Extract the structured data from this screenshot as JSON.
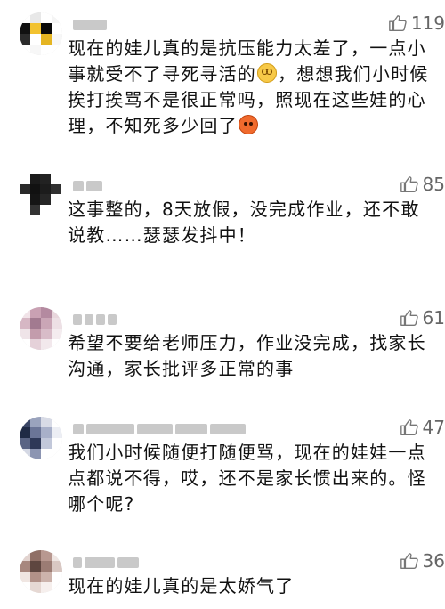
{
  "comments": [
    {
      "likes": "119",
      "text_a": "现在的娃儿真的是抗压能力太差了，一点小事就受不了寻死寻活的",
      "emoji_a": "dizzy-face-emoji",
      "text_b": "，想想我们小时候挨打挨骂不是很正常吗，照现在这些娃的心理，不知死多少回了",
      "emoji_b": "angry-face-emoji"
    },
    {
      "likes": "85",
      "text_a": "这事整的，8天放假，没完成作业，还不敢说教……瑟瑟发抖中！"
    },
    {
      "likes": "61",
      "text_a": "希望不要给老师压力，作业没完成，找家长沟通，家长批评多正常的事"
    },
    {
      "likes": "47",
      "text_a": "我们小时候随便打随便骂，现在的娃娃一点点都说不得，哎，还不是家长惯出来的。怪哪个呢?"
    },
    {
      "likes": "36",
      "text_a": "现在的娃儿真的是太娇气了"
    }
  ],
  "icons": {
    "like": "thumbs-up-icon",
    "avatar_blur": "pixelated-avatar"
  },
  "colors": {
    "text": "#111111",
    "count": "#666666",
    "background": "#ffffff"
  }
}
